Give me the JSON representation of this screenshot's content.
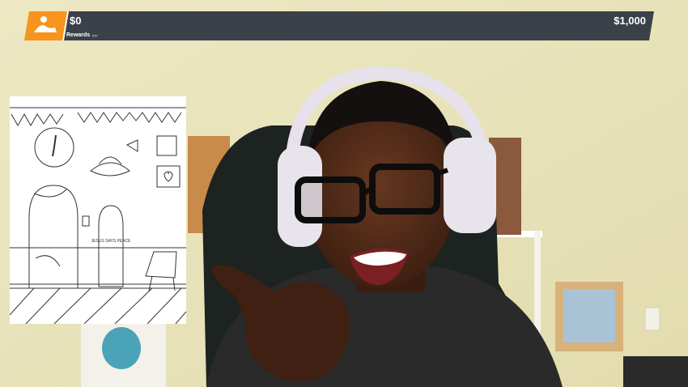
{
  "donation_bar": {
    "current_amount": "$0",
    "goal_amount": "$1,000",
    "rewards_label": "Rewards",
    "progress_fraction": 0,
    "colors": {
      "badge": "#f7941d",
      "track": "#3b4148",
      "text": "#ffffff"
    }
  },
  "coloring_page": {
    "poster_text": "JESUS SAYS PEACE"
  }
}
